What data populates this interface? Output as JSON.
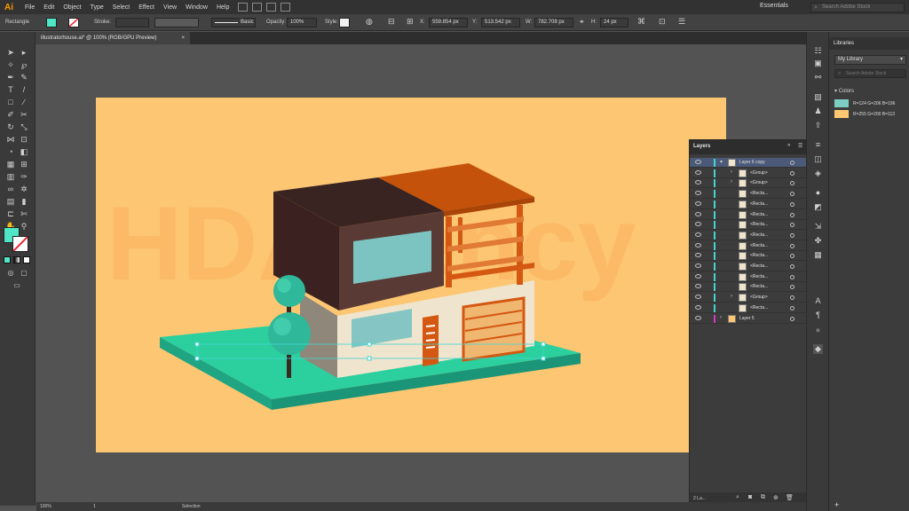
{
  "app": {
    "logo": "Ai"
  },
  "menu": [
    "File",
    "Edit",
    "Object",
    "Type",
    "Select",
    "Effect",
    "View",
    "Window",
    "Help"
  ],
  "workspace": "Essentials",
  "stock_search_placeholder": "Search Adobe Stock",
  "control": {
    "object_type": "Rectangle",
    "stroke_label": "Stroke:",
    "brush_label": "Basic",
    "opacity_label": "Opacity:",
    "opacity_value": "100%",
    "style_label": "Style:",
    "x_label": "X:",
    "x_value": "559.854 px",
    "y_label": "Y:",
    "y_value": "513.542 px",
    "w_label": "W:",
    "w_value": "782.708 px",
    "h_label": "H:",
    "h_value": "24 px",
    "fill_color": "#4ee6c6"
  },
  "document_tab": {
    "title": "illustratorhouse.ai* @ 100% (RGB/GPU Preview)",
    "close": "×"
  },
  "watermark": "HDAgency",
  "layers": {
    "title": "Layers",
    "rows": [
      {
        "name": "Layer 6 copy"
      },
      {
        "name": "<Group>"
      },
      {
        "name": "<Group>"
      },
      {
        "name": "<Recta..."
      },
      {
        "name": "<Recta..."
      },
      {
        "name": "<Recta..."
      },
      {
        "name": "<Recta..."
      },
      {
        "name": "<Recta..."
      },
      {
        "name": "<Recta..."
      },
      {
        "name": "<Recta..."
      },
      {
        "name": "<Recta..."
      },
      {
        "name": "<Recta..."
      },
      {
        "name": "<Recta..."
      },
      {
        "name": "<Group>"
      },
      {
        "name": "<Recta..."
      },
      {
        "name": "Layer 5"
      }
    ],
    "footer": "2 La..."
  },
  "libraries": {
    "tab": "Libraries",
    "library": "My Library",
    "search_placeholder": "Search Adobe Stock",
    "colors_heading": "Colors",
    "swatches": [
      {
        "label": "R=124 G=206 B=196",
        "hex": "#7cceC4"
      },
      {
        "label": "R=255 G=200 B=113",
        "hex": "#ffc871"
      }
    ]
  },
  "status": {
    "zoom": "100%",
    "page": "1",
    "tool": "Selection"
  },
  "colors": {
    "artboard": "#fcc672",
    "accent_teal": "#42d6d2",
    "house_dark": "#4a2b28",
    "house_orange": "#c4520a",
    "ground_teal": "#2ccf9e"
  }
}
